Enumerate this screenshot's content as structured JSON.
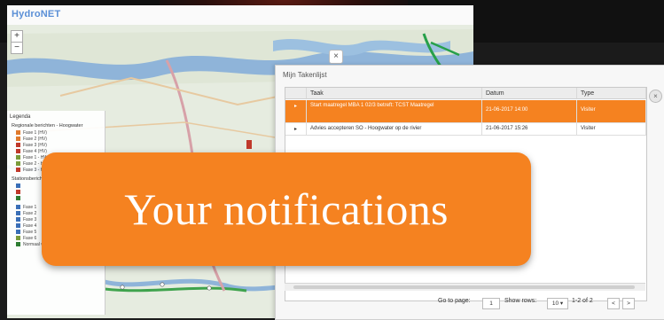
{
  "app": {
    "logo_text": "HydroNET"
  },
  "map": {
    "zoom_in_label": "+",
    "zoom_out_label": "−",
    "close_label": "×"
  },
  "legend": {
    "title": "Legenda",
    "sections": [
      {
        "heading": "Regionale berichten - Hoogwater",
        "items": [
          {
            "label": "Fase 1 (HV)",
            "color": "#e07a2c"
          },
          {
            "label": "Fase 2 (HV)",
            "color": "#e07a2c"
          },
          {
            "label": "Fase 3 (HV)",
            "color": "#c0392b"
          },
          {
            "label": "Fase 4 (HV)",
            "color": "#c0392b"
          },
          {
            "label": "Fase 1 - HWS",
            "color": "#7a9b3a"
          },
          {
            "label": "Fase 2 - HWS",
            "color": "#7a9b3a"
          },
          {
            "label": "Fase 3 - HWS",
            "color": "#c0392b"
          }
        ]
      },
      {
        "heading": "Stationsberichten",
        "items": [
          {
            "label": "",
            "color": "#3a6fb7"
          },
          {
            "label": "",
            "color": "#c0392b"
          },
          {
            "label": "",
            "color": "#2e7d32"
          }
        ]
      },
      {
        "heading": "",
        "items": [
          {
            "label": "Fase 1",
            "color": "#3a6fb7"
          },
          {
            "label": "Fase 2",
            "color": "#3a6fb7"
          },
          {
            "label": "Fase 3",
            "color": "#3a6fb7"
          },
          {
            "label": "Fase 4",
            "color": "#3a6fb7"
          },
          {
            "label": "Fase 5",
            "color": "#3a6fb7"
          },
          {
            "label": "Fase 6",
            "color": "#7a9b3a"
          },
          {
            "label": "Normaal waterpeil",
            "color": "#2e7d32"
          }
        ]
      }
    ]
  },
  "task_panel": {
    "title": "Mijn Takenlijst",
    "close_label": "×",
    "columns": [
      "Taak",
      "Datum",
      "Type"
    ],
    "rows": [
      {
        "taak": "Start maatregel MBA 1 02/3 betreft: TCST Maatregel",
        "datum": "21-06-2017 14:00",
        "type": "Visiter",
        "selected": true
      },
      {
        "taak": "Advies accepteren SO - Hoogwater op de rivier",
        "datum": "21-06-2017 15:26",
        "type": "Visiter",
        "selected": false
      }
    ],
    "pager": {
      "go_to_page_label": "Go to page:",
      "page_value": "1",
      "show_rows_label": "Show rows:",
      "rows_value": "10",
      "range_text": "1-2 of 2",
      "prev_label": "<",
      "next_label": ">"
    }
  },
  "notification": {
    "text": "Your notifications",
    "color": "#f58220"
  }
}
